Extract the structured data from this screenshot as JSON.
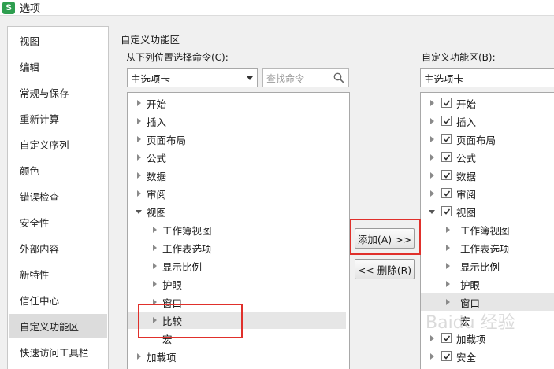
{
  "window": {
    "icon_letter": "S",
    "title": "选项"
  },
  "sidebar": {
    "items": [
      {
        "label": "视图",
        "active": false
      },
      {
        "label": "编辑",
        "active": false
      },
      {
        "label": "常规与保存",
        "active": false
      },
      {
        "label": "重新计算",
        "active": false
      },
      {
        "label": "自定义序列",
        "active": false
      },
      {
        "label": "颜色",
        "active": false
      },
      {
        "label": "错误检查",
        "active": false
      },
      {
        "label": "安全性",
        "active": false
      },
      {
        "label": "外部内容",
        "active": false
      },
      {
        "label": "新特性",
        "active": false
      },
      {
        "label": "信任中心",
        "active": false
      },
      {
        "label": "自定义功能区",
        "active": true
      },
      {
        "label": "快速访问工具栏",
        "active": false
      }
    ]
  },
  "main": {
    "group_title": "自定义功能区",
    "left": {
      "label": "从下列位置选择命令(C):",
      "select_value": "主选项卡",
      "search_placeholder": "查找命令",
      "tree": [
        {
          "label": "开始",
          "level": 0,
          "expander": "collapsed"
        },
        {
          "label": "插入",
          "level": 0,
          "expander": "collapsed"
        },
        {
          "label": "页面布局",
          "level": 0,
          "expander": "collapsed"
        },
        {
          "label": "公式",
          "level": 0,
          "expander": "collapsed"
        },
        {
          "label": "数据",
          "level": 0,
          "expander": "collapsed"
        },
        {
          "label": "审阅",
          "level": 0,
          "expander": "collapsed"
        },
        {
          "label": "视图",
          "level": 0,
          "expander": "expanded"
        },
        {
          "label": "工作簿视图",
          "level": 1,
          "expander": "collapsed"
        },
        {
          "label": "工作表选项",
          "level": 1,
          "expander": "collapsed"
        },
        {
          "label": "显示比例",
          "level": 1,
          "expander": "collapsed"
        },
        {
          "label": "护眼",
          "level": 1,
          "expander": "collapsed"
        },
        {
          "label": "窗口",
          "level": 1,
          "expander": "collapsed"
        },
        {
          "label": "比较",
          "level": 1,
          "expander": "collapsed",
          "selected": true
        },
        {
          "label": "宏",
          "level": 1,
          "expander": "none"
        },
        {
          "label": "加载项",
          "level": 0,
          "expander": "collapsed"
        }
      ]
    },
    "buttons": {
      "add": "添加(A) >>",
      "remove": "<< 删除(R)"
    },
    "right": {
      "label": "自定义功能区(B):",
      "select_value": "主选项卡",
      "tree": [
        {
          "label": "开始",
          "level": 0,
          "expander": "collapsed",
          "checked": true
        },
        {
          "label": "插入",
          "level": 0,
          "expander": "collapsed",
          "checked": true
        },
        {
          "label": "页面布局",
          "level": 0,
          "expander": "collapsed",
          "checked": true
        },
        {
          "label": "公式",
          "level": 0,
          "expander": "collapsed",
          "checked": true
        },
        {
          "label": "数据",
          "level": 0,
          "expander": "collapsed",
          "checked": true
        },
        {
          "label": "审阅",
          "level": 0,
          "expander": "collapsed",
          "checked": true
        },
        {
          "label": "视图",
          "level": 0,
          "expander": "expanded",
          "checked": true
        },
        {
          "label": "工作簿视图",
          "level": 1,
          "expander": "collapsed"
        },
        {
          "label": "工作表选项",
          "level": 1,
          "expander": "collapsed"
        },
        {
          "label": "显示比例",
          "level": 1,
          "expander": "collapsed"
        },
        {
          "label": "护眼",
          "level": 1,
          "expander": "collapsed"
        },
        {
          "label": "窗口",
          "level": 1,
          "expander": "collapsed",
          "selected": true
        },
        {
          "label": "宏",
          "level": 1,
          "expander": "none"
        },
        {
          "label": "加载项",
          "level": 0,
          "expander": "collapsed",
          "checked": true
        },
        {
          "label": "安全",
          "level": 0,
          "expander": "collapsed",
          "checked": true
        }
      ]
    }
  },
  "watermark": "Baidu 经验",
  "colors": {
    "highlight_box": "#e0302b",
    "selected_nav": "#dcdcdc"
  }
}
